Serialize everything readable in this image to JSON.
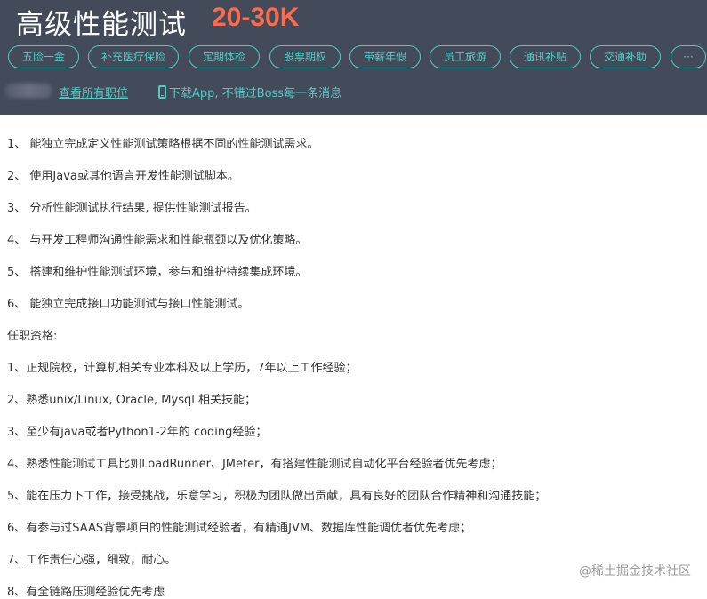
{
  "header": {
    "job_title": "高级性能测试",
    "salary": "20-30K",
    "benefit_tags": [
      "五险一金",
      "补充医疗保险",
      "定期体检",
      "股票期权",
      "带薪年假",
      "员工旅游",
      "通讯补贴",
      "交通补助",
      "···"
    ],
    "all_jobs_link": "查看所有职位",
    "app_promo": "下载App, 不错过Boss每一条消息"
  },
  "responsibilities": [
    "1、 能独立完成定义性能测试策略根据不同的性能测试需求。",
    "2、 使用Java或其他语言开发性能测试脚本。",
    "3、 分析性能测试执行结果, 提供性能测试报告。",
    "4、 与开发工程师沟通性能需求和性能瓶颈以及优化策略。",
    "5、 搭建和维护性能测试环境，参与和维护持续集成环境。",
    "6、 能独立完成接口功能测试与接口性能测试。"
  ],
  "qualifications_heading": "任职资格:",
  "qualifications": [
    "1、正规院校，计算机相关专业本科及以上学历，7年以上工作经验；",
    "2、熟悉unix/Linux, Oracle, Mysql 相关技能；",
    "3、至少有java或者Python1-2年的 coding经验；",
    "4、熟悉性能测试工具比如LoadRunner、JMeter，有搭建性能测试自动化平台经验者优先考虑；",
    "5、能在压力下工作，接受挑战，乐意学习，积极为团队做出贡献，具有良好的团队合作精神和沟通技能；",
    "6、有参与过SAAS背景项目的性能测试经验者，有精通JVM、数据库性能调优者优先考虑；",
    "7、工作责任心强，细致，耐心。",
    "8、有全链路压测经验优先考虑"
  ],
  "watermark": "@稀土掘金技术社区",
  "colors": {
    "header_bg": "#434b5a",
    "salary": "#fc6b4c",
    "accent": "#53cac3"
  },
  "icons": {
    "app_promo": "mobile-phone-icon"
  }
}
